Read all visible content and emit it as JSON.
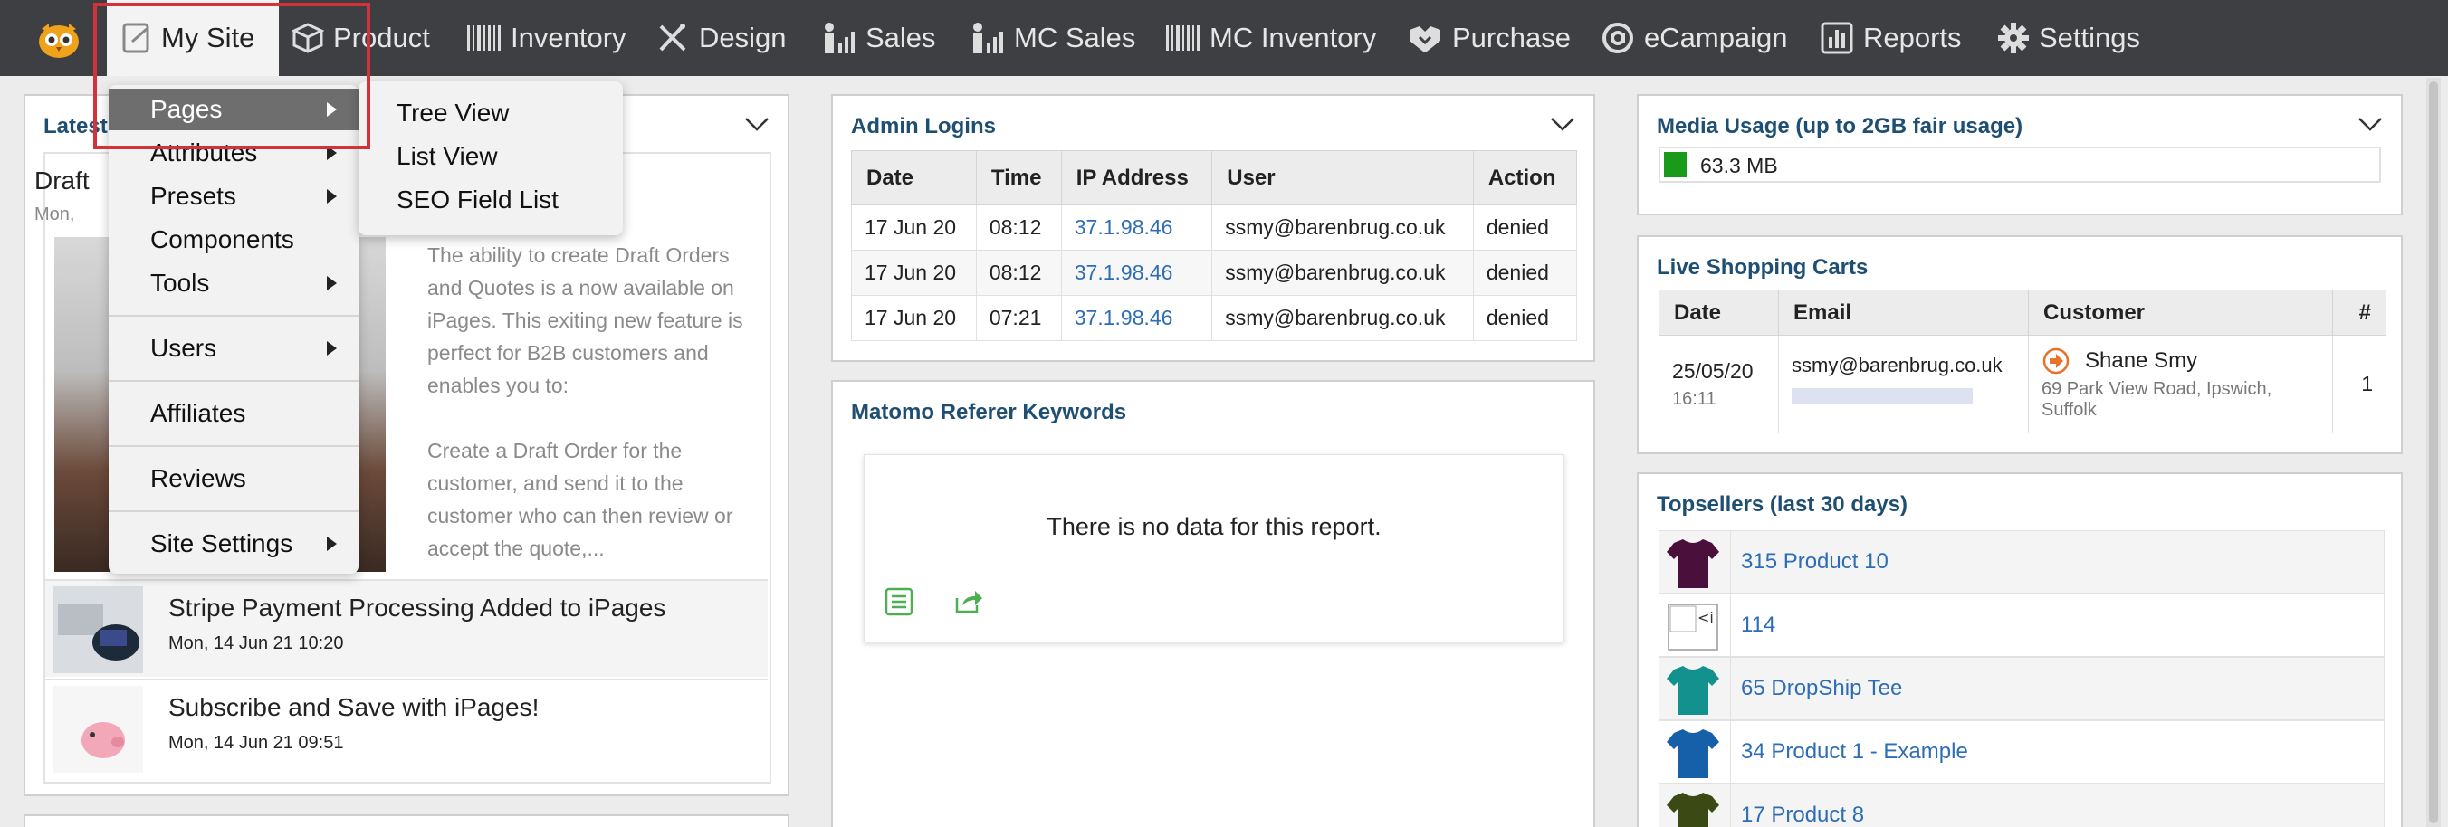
{
  "nav": {
    "items": [
      {
        "label": "My Site",
        "icon": "page-icon",
        "active": true
      },
      {
        "label": "Product",
        "icon": "box-icon"
      },
      {
        "label": "Inventory",
        "icon": "barcode-icon"
      },
      {
        "label": "Design",
        "icon": "pen-icon"
      },
      {
        "label": "Sales",
        "icon": "person-chart-icon"
      },
      {
        "label": "MC Sales",
        "icon": "person-chart-icon"
      },
      {
        "label": "MC Inventory",
        "icon": "barcode-icon"
      },
      {
        "label": "Purchase",
        "icon": "handshake-icon"
      },
      {
        "label": "eCampaign",
        "icon": "at-icon"
      },
      {
        "label": "Reports",
        "icon": "bar-chart-icon"
      },
      {
        "label": "Settings",
        "icon": "gear-icon"
      }
    ]
  },
  "mysite_menu": {
    "items": [
      "Pages",
      "Attributes",
      "Presets",
      "Components",
      "Tools",
      "Users",
      "Affiliates",
      "Reviews",
      "Site Settings"
    ]
  },
  "pages_submenu": {
    "items": [
      "Tree View",
      "List View",
      "SEO Field List"
    ]
  },
  "news": {
    "title_partial": "Latest",
    "featured_title_partial": "Draft",
    "featured_date_partial": "Mon,",
    "featured_body": [
      "The ability to create Draft Orders",
      "and Quotes is a now available on",
      "iPages. This exiting new feature is",
      "perfect for B2B customers and",
      "enables you to:",
      "",
      "Create a Draft Order for the",
      "customer, and send it to the",
      "customer who can then review or",
      "accept the quote,..."
    ],
    "rows": [
      {
        "title": "Stripe Payment Processing Added to iPages",
        "date": "Mon, 14 Jun 21 10:20"
      },
      {
        "title": "Subscribe and Save with iPages!",
        "date": "Mon, 14 Jun 21 09:51"
      }
    ]
  },
  "admin_logins": {
    "title": "Admin Logins",
    "headers": [
      "Date",
      "Time",
      "IP Address",
      "User",
      "Action"
    ],
    "rows": [
      [
        "17 Jun 20",
        "08:12",
        "37.1.98.46",
        "ssmy@barenbrug.co.uk",
        "denied"
      ],
      [
        "17 Jun 20",
        "08:12",
        "37.1.98.46",
        "ssmy@barenbrug.co.uk",
        "denied"
      ],
      [
        "17 Jun 20",
        "07:21",
        "37.1.98.46",
        "ssmy@barenbrug.co.uk",
        "denied"
      ]
    ]
  },
  "matomo": {
    "title": "Matomo Referer Keywords",
    "empty_text": "There is no data for this report."
  },
  "media_usage": {
    "title": "Media Usage (up to 2GB fair usage)",
    "value_text": "63.3 MB",
    "fraction": 0.032
  },
  "carts": {
    "title": "Live Shopping Carts",
    "headers": [
      "Date",
      "Email",
      "Customer",
      "#"
    ],
    "row": {
      "date": "25/05/20",
      "time": "16:11",
      "email": "ssmy@barenbrug.co.uk",
      "customer": "Shane Smy",
      "address_line1": "69 Park View Road, Ipswich,",
      "address_line2": "Suffolk",
      "count": "1"
    }
  },
  "topsellers": {
    "title": "Topsellers (last 30 days)",
    "items": [
      {
        "label": "315 Product 10",
        "color": "#4a0f3a"
      },
      {
        "label": "114",
        "color": ""
      },
      {
        "label": "65 DropShip Tee",
        "color": "#13918f"
      },
      {
        "label": "34 Product 1 - Example",
        "color": "#1560a8"
      },
      {
        "label": "17 Product 8",
        "color": "#3b4a14"
      }
    ]
  },
  "colors": {
    "nav_bg": "#3d3f43",
    "accent_link": "#2d6db5",
    "panel_title": "#1e4f73",
    "highlight": "#d2323c",
    "usage_bar": "#1a9a1a"
  }
}
